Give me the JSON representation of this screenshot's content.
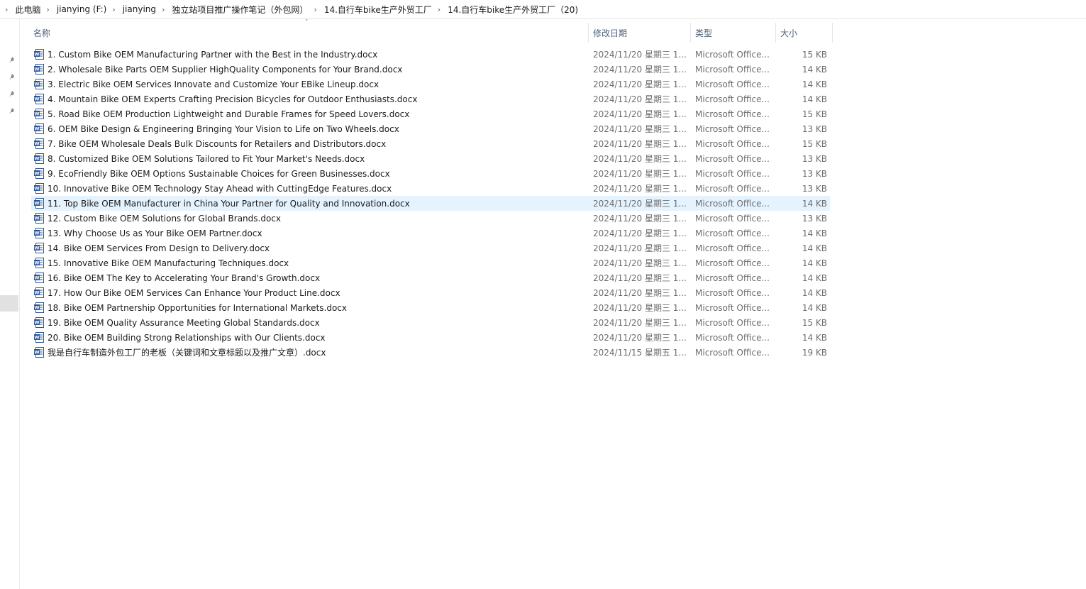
{
  "breadcrumb": [
    "此电脑",
    "jianying (F:)",
    "jianying",
    "独立站项目推广操作笔记（外包网）",
    "14.自行车bike生产外贸工厂",
    "14.自行车bike生产外贸工厂（20)"
  ],
  "columns": {
    "name": "名称",
    "date": "修改日期",
    "type": "类型",
    "size": "大小"
  },
  "icons": {
    "pin": "pin-icon",
    "file": "word-document-icon",
    "chevron": "chevron-right-icon",
    "sort": "sort-up-icon"
  },
  "files": [
    {
      "name": "1. Custom Bike OEM Manufacturing Partner with the Best in the Industry.docx",
      "date": "2024/11/20 星期三 1...",
      "type": "Microsoft Office...",
      "size": "15 KB"
    },
    {
      "name": "2. Wholesale Bike Parts OEM Supplier HighQuality Components for Your Brand.docx",
      "date": "2024/11/20 星期三 1...",
      "type": "Microsoft Office...",
      "size": "14 KB"
    },
    {
      "name": "3. Electric Bike OEM Services Innovate and Customize Your EBike Lineup.docx",
      "date": "2024/11/20 星期三 1...",
      "type": "Microsoft Office...",
      "size": "14 KB"
    },
    {
      "name": "4. Mountain Bike OEM Experts Crafting Precision Bicycles for Outdoor Enthusiasts.docx",
      "date": "2024/11/20 星期三 1...",
      "type": "Microsoft Office...",
      "size": "14 KB"
    },
    {
      "name": "5. Road Bike OEM Production Lightweight and Durable Frames for Speed Lovers.docx",
      "date": "2024/11/20 星期三 1...",
      "type": "Microsoft Office...",
      "size": "15 KB"
    },
    {
      "name": "6. OEM Bike Design & Engineering Bringing Your Vision to Life on Two Wheels.docx",
      "date": "2024/11/20 星期三 1...",
      "type": "Microsoft Office...",
      "size": "13 KB"
    },
    {
      "name": "7. Bike OEM Wholesale Deals Bulk Discounts for Retailers and Distributors.docx",
      "date": "2024/11/20 星期三 1...",
      "type": "Microsoft Office...",
      "size": "15 KB"
    },
    {
      "name": "8. Customized Bike OEM Solutions Tailored to Fit Your Market's Needs.docx",
      "date": "2024/11/20 星期三 1...",
      "type": "Microsoft Office...",
      "size": "13 KB"
    },
    {
      "name": "9. EcoFriendly Bike OEM Options Sustainable Choices for Green Businesses.docx",
      "date": "2024/11/20 星期三 1...",
      "type": "Microsoft Office...",
      "size": "13 KB"
    },
    {
      "name": "10. Innovative Bike OEM Technology Stay Ahead with CuttingEdge Features.docx",
      "date": "2024/11/20 星期三 1...",
      "type": "Microsoft Office...",
      "size": "13 KB"
    },
    {
      "name": "11. Top Bike OEM Manufacturer in China Your Partner for Quality and Innovation.docx",
      "date": "2024/11/20 星期三 1...",
      "type": "Microsoft Office...",
      "size": "14 KB",
      "selected": true
    },
    {
      "name": "12. Custom Bike OEM Solutions for Global Brands.docx",
      "date": "2024/11/20 星期三 1...",
      "type": "Microsoft Office...",
      "size": "13 KB"
    },
    {
      "name": "13. Why Choose Us as Your Bike OEM Partner.docx",
      "date": "2024/11/20 星期三 1...",
      "type": "Microsoft Office...",
      "size": "14 KB"
    },
    {
      "name": "14. Bike OEM Services From Design to Delivery.docx",
      "date": "2024/11/20 星期三 1...",
      "type": "Microsoft Office...",
      "size": "14 KB"
    },
    {
      "name": "15. Innovative Bike OEM Manufacturing Techniques.docx",
      "date": "2024/11/20 星期三 1...",
      "type": "Microsoft Office...",
      "size": "14 KB"
    },
    {
      "name": "16. Bike OEM The Key to Accelerating Your Brand's Growth.docx",
      "date": "2024/11/20 星期三 1...",
      "type": "Microsoft Office...",
      "size": "14 KB"
    },
    {
      "name": "17. How Our Bike OEM Services Can Enhance Your Product Line.docx",
      "date": "2024/11/20 星期三 1...",
      "type": "Microsoft Office...",
      "size": "14 KB"
    },
    {
      "name": "18. Bike OEM Partnership Opportunities for International Markets.docx",
      "date": "2024/11/20 星期三 1...",
      "type": "Microsoft Office...",
      "size": "14 KB"
    },
    {
      "name": "19. Bike OEM Quality Assurance Meeting Global Standards.docx",
      "date": "2024/11/20 星期三 1...",
      "type": "Microsoft Office...",
      "size": "15 KB"
    },
    {
      "name": "20. Bike OEM Building Strong Relationships with Our Clients.docx",
      "date": "2024/11/20 星期三 1...",
      "type": "Microsoft Office...",
      "size": "14 KB"
    },
    {
      "name": "我是自行车制造外包工厂的老板（关键词和文章标题以及推广文章）.docx",
      "date": "2024/11/15 星期五 1...",
      "type": "Microsoft Office...",
      "size": "19 KB"
    }
  ]
}
